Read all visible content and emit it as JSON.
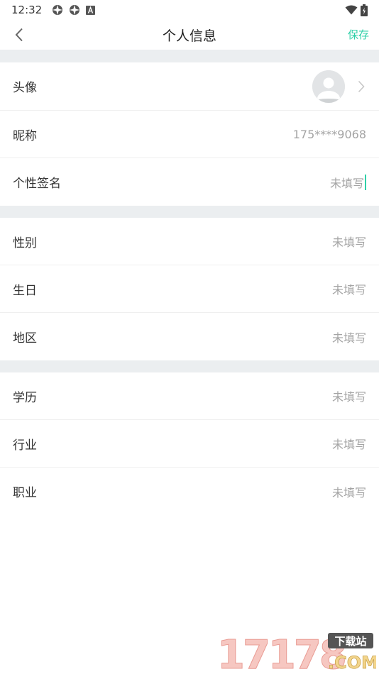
{
  "status": {
    "time": "12:32"
  },
  "header": {
    "title": "个人信息",
    "save_label": "保存"
  },
  "sections": [
    [
      {
        "label": "头像",
        "type": "avatar"
      },
      {
        "label": "昵称",
        "value": "175****9068"
      },
      {
        "label": "个性签名",
        "value": "未填写",
        "focused": true
      }
    ],
    [
      {
        "label": "性别",
        "value": "未填写"
      },
      {
        "label": "生日",
        "value": "未填写"
      },
      {
        "label": "地区",
        "value": "未填写"
      }
    ],
    [
      {
        "label": "学历",
        "value": "未填写"
      },
      {
        "label": "行业",
        "value": "未填写"
      },
      {
        "label": "职业",
        "value": "未填写"
      }
    ]
  ],
  "watermark": {
    "number": "17178",
    "tag": "下载站",
    "domain": ".COM"
  },
  "colors": {
    "accent": "#2fd0a8",
    "gap": "#ebeef0",
    "value_text": "#a4a4a4"
  }
}
